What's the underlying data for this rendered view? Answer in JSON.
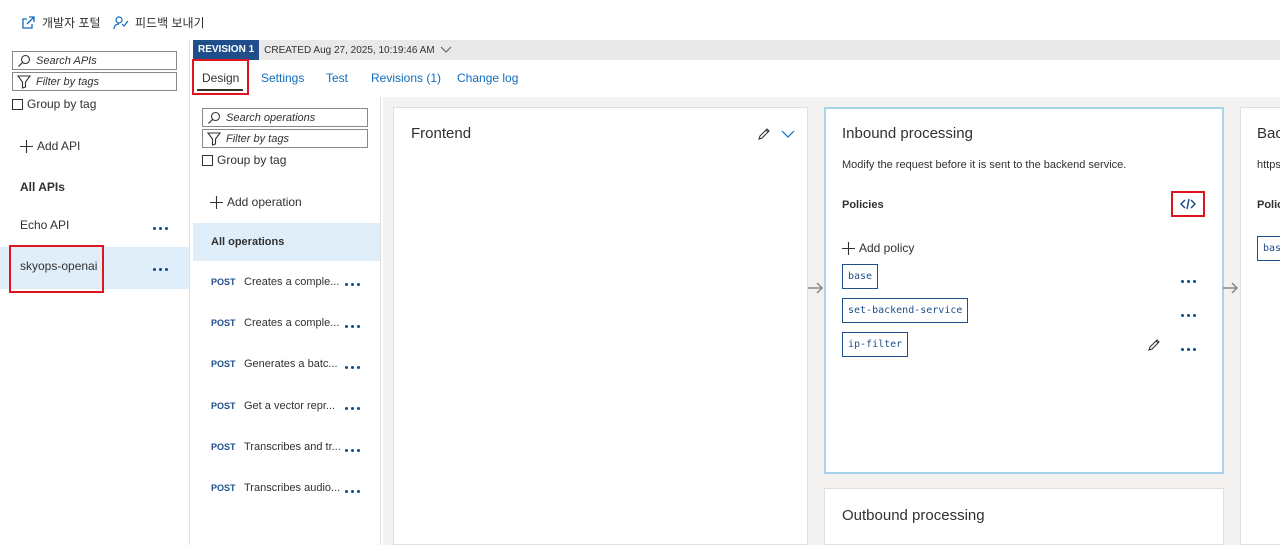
{
  "toolbar": {
    "developer_portal": "개발자 포털",
    "feedback": "피드백 보내기"
  },
  "api_panel": {
    "search_placeholder": "Search APIs",
    "filter_placeholder": "Filter by tags",
    "group_by_tag": "Group by tag",
    "add_api": "Add API",
    "all_apis": "All APIs",
    "apis": [
      {
        "name": "Echo API"
      },
      {
        "name": "skyops-openai"
      }
    ]
  },
  "revision": {
    "tag": "REVISION 1",
    "created": "CREATED Aug 27, 2025, 10:19:46 AM"
  },
  "tabs": [
    "Design",
    "Settings",
    "Test",
    "Revisions (1)",
    "Change log"
  ],
  "ops_panel": {
    "search_placeholder": "Search operations",
    "filter_placeholder": "Filter by tags",
    "group_by_tag": "Group by tag",
    "add_operation": "Add operation",
    "all_operations": "All operations",
    "operations": [
      {
        "verb": "POST",
        "name": "Creates a comple..."
      },
      {
        "verb": "POST",
        "name": "Creates a comple..."
      },
      {
        "verb": "POST",
        "name": "Generates a batc..."
      },
      {
        "verb": "POST",
        "name": "Get a vector repr..."
      },
      {
        "verb": "POST",
        "name": "Transcribes and tr..."
      },
      {
        "verb": "POST",
        "name": "Transcribes audio..."
      }
    ]
  },
  "frontend": {
    "title": "Frontend"
  },
  "inbound": {
    "title": "Inbound processing",
    "description": "Modify the request before it is sent to the backend service.",
    "policies_label": "Policies",
    "add_policy": "Add policy",
    "policies": [
      "base",
      "set-backend-service",
      "ip-filter"
    ]
  },
  "backend": {
    "title": "Backe",
    "url": "https",
    "policies_label": "Polic",
    "policy": "bas"
  },
  "outbound": {
    "title": "Outbound processing"
  },
  "colors": {
    "accent": "#0f6cbd",
    "highlight": "#e0141e",
    "revision_tag": "#1f4e8a"
  }
}
